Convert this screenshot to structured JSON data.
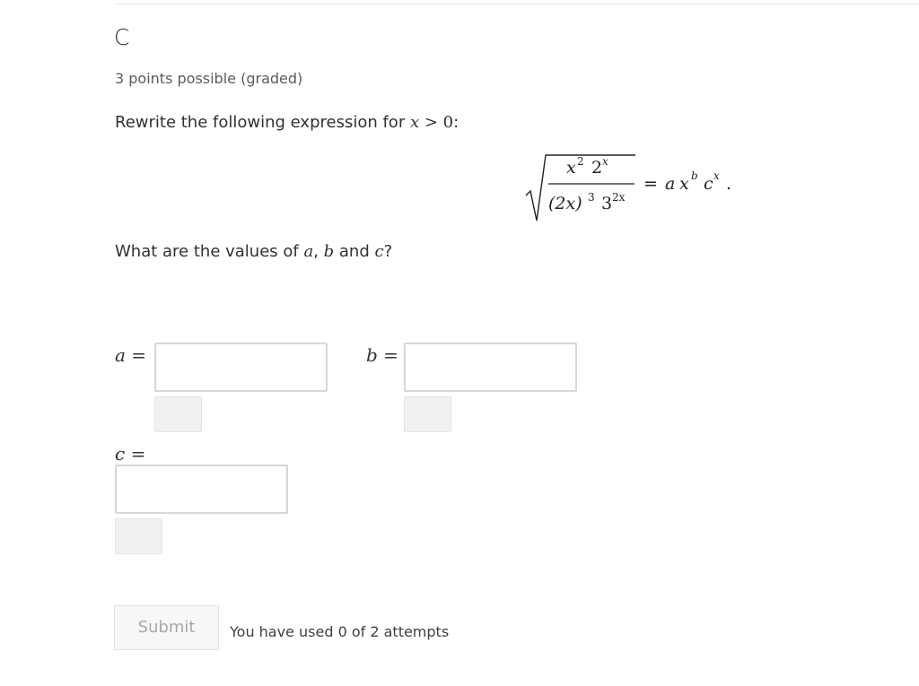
{
  "problem": {
    "title": "C",
    "points": "3 points possible (graded)",
    "prompt_prefix": "Rewrite the following expression for ",
    "prompt_condition_var": "x",
    "prompt_condition_op": " > ",
    "prompt_condition_val": "0",
    "prompt_suffix": ":",
    "question_prefix": "What are the values of ",
    "question_a": "a",
    "question_sep1": ", ",
    "question_b": "b",
    "question_and": " and ",
    "question_c": "c",
    "question_suffix": "?"
  },
  "formula": {
    "num_x": "x",
    "num_x_exp": "2",
    "num_base": "2",
    "num_base_exp": "x",
    "den_paren": "(2x)",
    "den_paren_exp": "3",
    "den_base": "3",
    "den_base_exp": "2x",
    "eq": "=",
    "rhs_a": "a",
    "rhs_x": "x",
    "rhs_x_exp": "b",
    "rhs_c": "c",
    "rhs_c_exp": "x",
    "rhs_period": "."
  },
  "inputs": {
    "a_label_var": "a",
    "b_label_var": "b",
    "c_label_var": "c",
    "eq": "=",
    "a_value": "",
    "b_value": "",
    "c_value": ""
  },
  "actions": {
    "submit_label": "Submit",
    "attempts_text": "You have used 0 of 2 attempts"
  }
}
